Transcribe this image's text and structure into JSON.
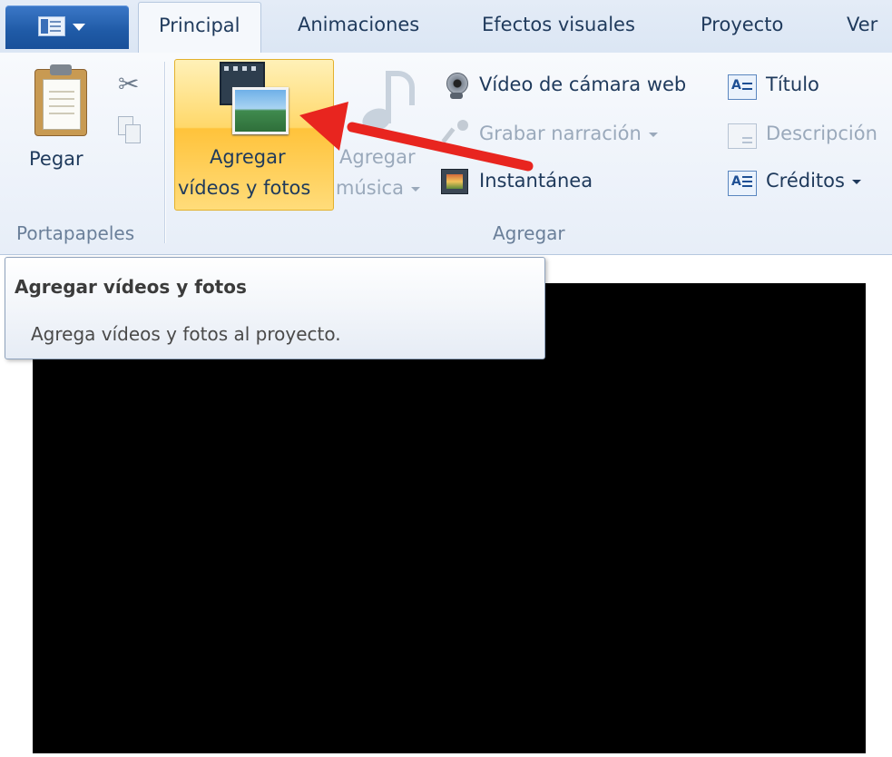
{
  "tabs": [
    "Principal",
    "Animaciones",
    "Efectos visuales",
    "Proyecto",
    "Ver"
  ],
  "active_tab": "Principal",
  "clipboard": {
    "paste_label": "Pegar",
    "group_label": "Portapapeles"
  },
  "add_group": {
    "add_videos_photos": [
      "Agregar",
      "vídeos y fotos"
    ],
    "add_music": [
      "Agregar",
      "música"
    ],
    "webcam_video": "Vídeo de cámara web",
    "record_narration": "Grabar narración",
    "snapshot": "Instantánea",
    "title": "Título",
    "caption": "Descripción",
    "credits": "Créditos",
    "group_label": "Agregar"
  },
  "tooltip": {
    "title": "Agregar vídeos y fotos",
    "body": "Agrega vídeos y fotos al proyecto."
  },
  "colors": {
    "annotation_arrow": "#e8251f",
    "highlight": "#ffd86a",
    "preview_bg": "#000000"
  }
}
